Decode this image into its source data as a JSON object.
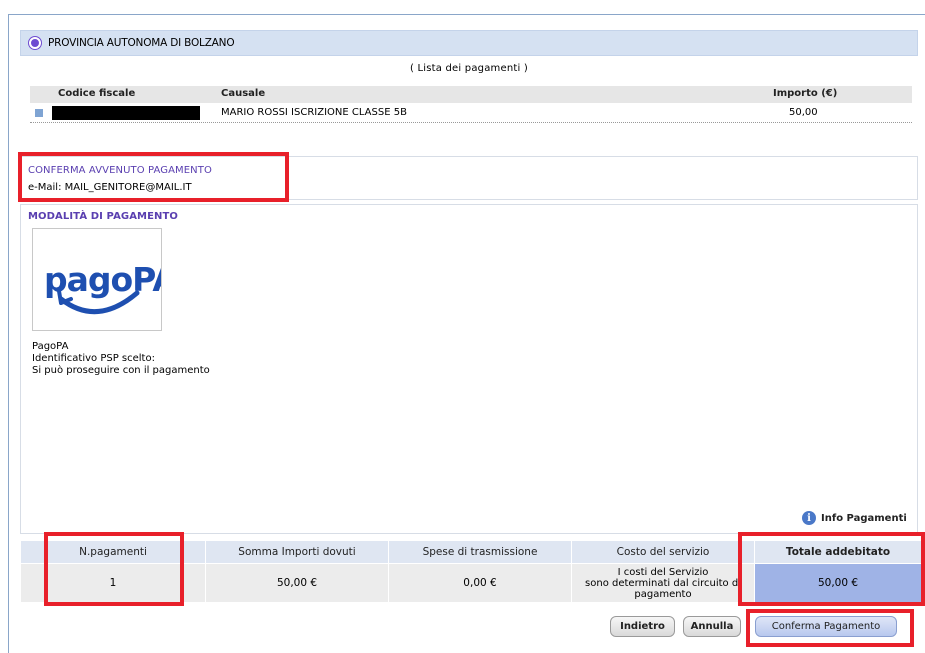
{
  "ente": {
    "name": "PROVINCIA AUTONOMA DI BOLZANO"
  },
  "lista": {
    "caption": "( Lista dei pagamenti )",
    "columns": {
      "codice_fiscale": "Codice fiscale",
      "causale": "Causale",
      "importo": "Importo (€)"
    },
    "rows": [
      {
        "codice_fiscale": "",
        "causale": "MARIO ROSSI ISCRIZIONE CLASSE 5B",
        "importo": "50,00"
      }
    ]
  },
  "conferma": {
    "title": "CONFERMA AVVENUTO PAGAMENTO",
    "email": "e-Mail: MAIL_GENITORE@MAIL.IT"
  },
  "modalita": {
    "title": "MODALITÀ DI PAGAMENTO",
    "logo_text": "pagoPA",
    "name": "PagoPA",
    "psp": "Identificativo PSP scelto:",
    "note": "Si può proseguire con il pagamento"
  },
  "info": {
    "label": "Info Pagamenti",
    "icon": "info-icon"
  },
  "summary": {
    "headers": [
      "N.pagamenti",
      "Somma Importi dovuti",
      "Spese di trasmissione",
      "Costo del servizio",
      "Totale addebitato"
    ],
    "values": {
      "n": "1",
      "somma": "50,00 €",
      "spese": "0,00 €",
      "costo_l1": "I costi del Servizio",
      "costo_l2": "sono determinati dal circuito di",
      "costo_l3": "pagamento",
      "totale": "50,00 €"
    }
  },
  "buttons": {
    "indietro": "Indietro",
    "annulla": "Annulla",
    "conferma": "Conferma Pagamento"
  },
  "colors": {
    "accent": "#5a3fb0",
    "highlight": "#e8202a",
    "header_bg": "#d5e1f2"
  }
}
